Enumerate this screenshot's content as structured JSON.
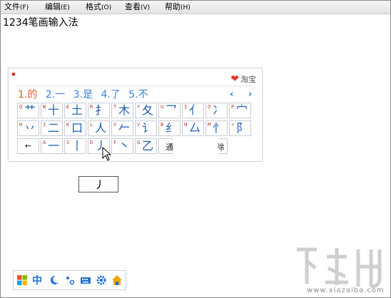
{
  "menu": [
    {
      "label": "文件",
      "key": "(F)"
    },
    {
      "label": "编辑",
      "key": "(E)"
    },
    {
      "label": "格式",
      "key": "(O)"
    },
    {
      "label": "查看",
      "key": "(V)"
    },
    {
      "label": "帮助",
      "key": "(H)"
    }
  ],
  "document": {
    "text": "1234笔画输入法"
  },
  "ime": {
    "brand": "淘宝",
    "candidates": [
      "1.的",
      "2.一",
      "3.是",
      "4.了",
      "5.不"
    ],
    "nav": {
      "prev": "‹",
      "next": "›"
    },
    "row1": [
      {
        "l": "Q",
        "s": "艹"
      },
      {
        "l": "W",
        "s": "十"
      },
      {
        "l": "E",
        "s": "土"
      },
      {
        "l": "R",
        "s": "扌"
      },
      {
        "l": "T",
        "s": "木"
      },
      {
        "l": "Y",
        "s": "夂"
      },
      {
        "l": "U",
        "s": "乛"
      },
      {
        "l": "I",
        "s": "亻"
      },
      {
        "l": "O",
        "s": "冫"
      },
      {
        "l": "P",
        "s": "宀"
      }
    ],
    "row2": [
      {
        "l": "H",
        "s": "丷"
      },
      {
        "l": "J",
        "s": "二"
      },
      {
        "l": "K",
        "s": "口"
      },
      {
        "l": "L",
        "s": "人"
      },
      {
        "l": "V",
        "s": "𠂉"
      },
      {
        "l": "V",
        "s": "讠"
      },
      {
        "l": "B",
        "s": "纟"
      },
      {
        "l": "N",
        "s": "厶"
      },
      {
        "l": "M",
        "s": "忄"
      },
      {
        "l": "<",
        "s": "阝"
      }
    ],
    "row3": [
      {
        "l": "",
        "s": "←"
      },
      {
        "l": "A",
        "s": "一"
      },
      {
        "l": "S",
        "s": "丨"
      },
      {
        "l": "D",
        "s": "丿"
      },
      {
        "l": "F",
        "s": "丶"
      },
      {
        "l": "G",
        "s": "乙"
      },
      {
        "l": "Z",
        "s": "通"
      },
      {
        "l": "",
        "s": "符号"
      },
      {
        "l": "",
        "s": "清除"
      }
    ]
  },
  "composition": {
    "text": "丿"
  },
  "taskbar": {
    "icons": [
      "windows-logo-icon",
      "chinese-mode-icon",
      "moon-icon",
      "punctuation-icon",
      "keyboard-icon",
      "gear-icon",
      "home-icon"
    ],
    "mode_label": "中"
  },
  "watermark": {
    "url": "www.xiazaiba.com"
  }
}
